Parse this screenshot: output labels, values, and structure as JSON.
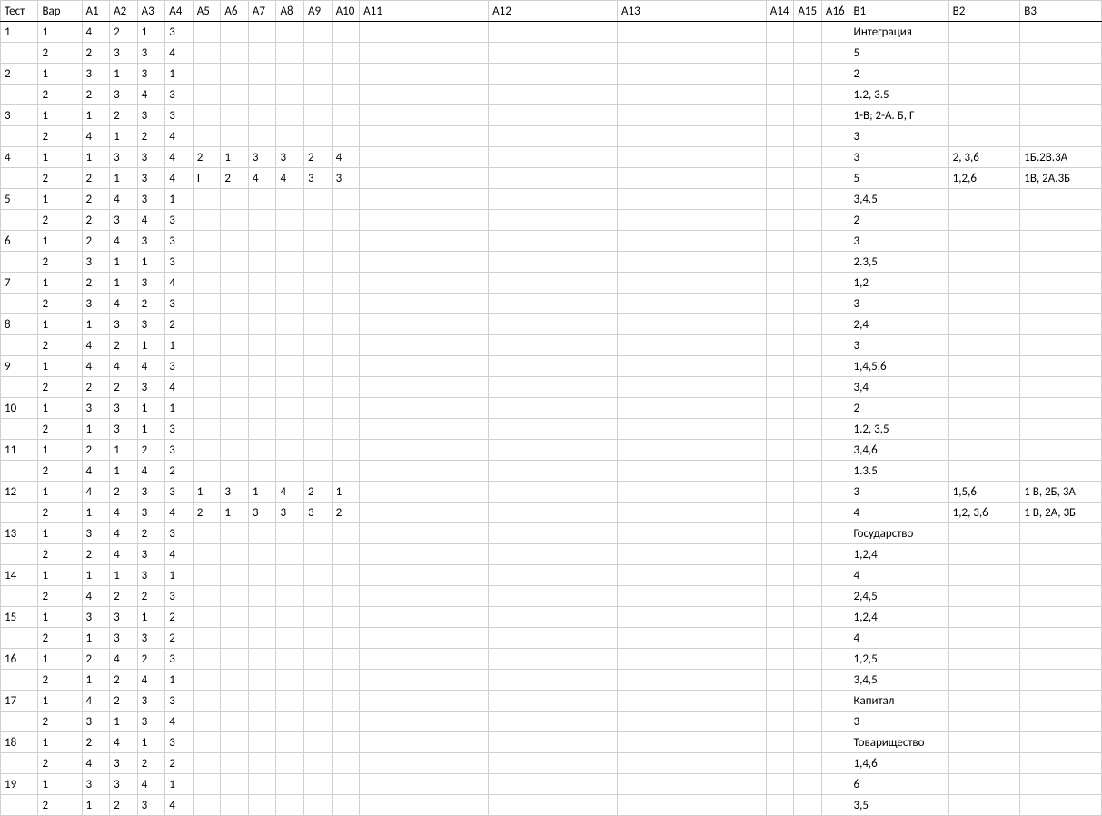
{
  "headers": [
    "Тест",
    "Вар",
    "А1",
    "А2",
    "А3",
    "А4",
    "А5",
    "А6",
    "А7",
    "А8",
    "А9",
    "А10",
    "А11",
    "А12",
    "А13",
    "А14",
    "А15",
    "А16",
    "В1",
    "В2",
    "В3"
  ],
  "rows": [
    [
      "1",
      "1",
      "4",
      "2",
      "1",
      "3",
      "",
      "",
      "",
      "",
      "",
      "",
      "",
      "",
      "",
      "",
      "",
      "",
      "Интеграция",
      "",
      ""
    ],
    [
      "",
      "2",
      "2",
      "3",
      "3",
      "4",
      "",
      "",
      "",
      "",
      "",
      "",
      "",
      "",
      "",
      "",
      "",
      "",
      "5",
      "",
      ""
    ],
    [
      "2",
      "1",
      "3",
      "1",
      "3",
      "1",
      "",
      "",
      "",
      "",
      "",
      "",
      "",
      "",
      "",
      "",
      "",
      "",
      "2",
      "",
      ""
    ],
    [
      "",
      "2",
      "2",
      "3",
      "4",
      "3",
      "",
      "",
      "",
      "",
      "",
      "",
      "",
      "",
      "",
      "",
      "",
      "",
      "1.2, 3.5",
      "",
      ""
    ],
    [
      "3",
      "1",
      "1",
      "2",
      "3",
      "3",
      "",
      "",
      "",
      "",
      "",
      "",
      "",
      "",
      "",
      "",
      "",
      "",
      "1-В; 2-А. Б, Г",
      "",
      ""
    ],
    [
      "",
      "2",
      "4",
      "1",
      "2",
      "4",
      "",
      "",
      "",
      "",
      "",
      "",
      "",
      "",
      "",
      "",
      "",
      "",
      "3",
      "",
      ""
    ],
    [
      "4",
      "1",
      "1",
      "3",
      "3",
      "4",
      "2",
      "1",
      "3",
      "3",
      "2",
      "4",
      "",
      "",
      "",
      "",
      "",
      "",
      "3",
      "2, 3,6",
      "1Б.2В.3А"
    ],
    [
      "",
      "2",
      "2",
      "1",
      "3",
      "4",
      "I",
      "2",
      "4",
      "4",
      "3",
      "3",
      "",
      "",
      "",
      "",
      "",
      "",
      "5",
      "1,2,6",
      "1В, 2А.3Б"
    ],
    [
      "5",
      "1",
      "2",
      "4",
      "3",
      "1",
      "",
      "",
      "",
      "",
      "",
      "",
      "",
      "",
      "",
      "",
      "",
      "",
      "3,4.5",
      "",
      ""
    ],
    [
      "",
      "2",
      "2",
      "3",
      "4",
      "3",
      "",
      "",
      "",
      "",
      "",
      "",
      "",
      "",
      "",
      "",
      "",
      "",
      "2",
      "",
      ""
    ],
    [
      "6",
      "1",
      "2",
      "4",
      "3",
      "3",
      "",
      "",
      "",
      "",
      "",
      "",
      "",
      "",
      "",
      "",
      "",
      "",
      "3",
      "",
      ""
    ],
    [
      "",
      "2",
      "3",
      "1",
      "1",
      "3",
      "",
      "",
      "",
      "",
      "",
      "",
      "",
      "",
      "",
      "",
      "",
      "",
      "2.3,5",
      "",
      ""
    ],
    [
      "7",
      "1",
      "2",
      "1",
      "3",
      "4",
      "",
      "",
      "",
      "",
      "",
      "",
      "",
      "",
      "",
      "",
      "",
      "",
      "1,2",
      "",
      ""
    ],
    [
      "",
      "2",
      "3",
      "4",
      "2",
      "3",
      "",
      "",
      "",
      "",
      "",
      "",
      "",
      "",
      "",
      "",
      "",
      "",
      "3",
      "",
      ""
    ],
    [
      "8",
      "1",
      "1",
      "3",
      "3",
      "2",
      "",
      "",
      "",
      "",
      "",
      "",
      "",
      "",
      "",
      "",
      "",
      "",
      "2,4",
      "",
      ""
    ],
    [
      "",
      "2",
      "4",
      "2",
      "1",
      "1",
      "",
      "",
      "",
      "",
      "",
      "",
      "",
      "",
      "",
      "",
      "",
      "",
      "3",
      "",
      ""
    ],
    [
      "9",
      "1",
      "4",
      "4",
      "4",
      "3",
      "",
      "",
      "",
      "",
      "",
      "",
      "",
      "",
      "",
      "",
      "",
      "",
      "1,4,5,6",
      "",
      ""
    ],
    [
      "",
      "2",
      "2",
      "2",
      "3",
      "4",
      "",
      "",
      "",
      "",
      "",
      "",
      "",
      "",
      "",
      "",
      "",
      "",
      "3,4",
      "",
      ""
    ],
    [
      "10",
      "1",
      "3",
      "3",
      "1",
      "1",
      "",
      "",
      "",
      "",
      "",
      "",
      "",
      "",
      "",
      "",
      "",
      "",
      "2",
      "",
      ""
    ],
    [
      "",
      "2",
      "1",
      "3",
      "1",
      "3",
      "",
      "",
      "",
      "",
      "",
      "",
      "",
      "",
      "",
      "",
      "",
      "",
      "1.2, 3,5",
      "",
      ""
    ],
    [
      "11",
      "1",
      "2",
      "1",
      "2",
      "3",
      "",
      "",
      "",
      "",
      "",
      "",
      "",
      "",
      "",
      "",
      "",
      "",
      "3,4,6",
      "",
      ""
    ],
    [
      "",
      "2",
      "4",
      "1",
      "4",
      "2",
      "",
      "",
      "",
      "",
      "",
      "",
      "",
      "",
      "",
      "",
      "",
      "",
      "1.3.5",
      "",
      ""
    ],
    [
      "12",
      "1",
      "4",
      "2",
      "3",
      "3",
      "1",
      "3",
      "1",
      "4",
      "2",
      "1",
      "",
      "",
      "",
      "",
      "",
      "",
      "3",
      "1,5,6",
      "1 В, 2Б, 3А"
    ],
    [
      "",
      "2",
      "1",
      "4",
      "3",
      "4",
      "2",
      "1",
      "3",
      "3",
      "3",
      "2",
      "",
      "",
      "",
      "",
      "",
      "",
      "4",
      "1,2, 3,6",
      "1 В, 2А, 3Б"
    ],
    [
      "13",
      "1",
      "3",
      "4",
      "2",
      "3",
      "",
      "",
      "",
      "",
      "",
      "",
      "",
      "",
      "",
      "",
      "",
      "",
      "Государство",
      "",
      ""
    ],
    [
      "",
      "2",
      "2",
      "4",
      "3",
      "4",
      "",
      "",
      "",
      "",
      "",
      "",
      "",
      "",
      "",
      "",
      "",
      "",
      "1,2,4",
      "",
      ""
    ],
    [
      "14",
      "1",
      "1",
      "1",
      "3",
      "1",
      "",
      "",
      "",
      "",
      "",
      "",
      "",
      "",
      "",
      "",
      "",
      "",
      "4",
      "",
      ""
    ],
    [
      "",
      "2",
      "4",
      "2",
      "2",
      "3",
      "",
      "",
      "",
      "",
      "",
      "",
      "",
      "",
      "",
      "",
      "",
      "",
      "2,4,5",
      "",
      ""
    ],
    [
      "15",
      "1",
      "3",
      "3",
      "1",
      "2",
      "",
      "",
      "",
      "",
      "",
      "",
      "",
      "",
      "",
      "",
      "",
      "",
      "1,2,4",
      "",
      ""
    ],
    [
      "",
      "2",
      "1",
      "3",
      "3",
      "2",
      "",
      "",
      "",
      "",
      "",
      "",
      "",
      "",
      "",
      "",
      "",
      "",
      "4",
      "",
      ""
    ],
    [
      "16",
      "1",
      "2",
      "4",
      "2",
      "3",
      "",
      "",
      "",
      "",
      "",
      "",
      "",
      "",
      "",
      "",
      "",
      "",
      "1,2,5",
      "",
      ""
    ],
    [
      "",
      "2",
      "1",
      "2",
      "4",
      "1",
      "",
      "",
      "",
      "",
      "",
      "",
      "",
      "",
      "",
      "",
      "",
      "",
      "3,4,5",
      "",
      ""
    ],
    [
      "17",
      "1",
      "4",
      "2",
      "3",
      "3",
      "",
      "",
      "",
      "",
      "",
      "",
      "",
      "",
      "",
      "",
      "",
      "",
      "Капитал",
      "",
      ""
    ],
    [
      "",
      "2",
      "3",
      "1",
      "3",
      "4",
      "",
      "",
      "",
      "",
      "",
      "",
      "",
      "",
      "",
      "",
      "",
      "",
      "3",
      "",
      ""
    ],
    [
      "18",
      "1",
      "2",
      "4",
      "1",
      "3",
      "",
      "",
      "",
      "",
      "",
      "",
      "",
      "",
      "",
      "",
      "",
      "",
      "Товарищество",
      "",
      ""
    ],
    [
      "",
      "2",
      "4",
      "3",
      "2",
      "2",
      "",
      "",
      "",
      "",
      "",
      "",
      "",
      "",
      "",
      "",
      "",
      "",
      "1,4,6",
      "",
      ""
    ],
    [
      "19",
      "1",
      "3",
      "3",
      "4",
      "1",
      "",
      "",
      "",
      "",
      "",
      "",
      "",
      "",
      "",
      "",
      "",
      "",
      "6",
      "",
      ""
    ],
    [
      "",
      "2",
      "1",
      "2",
      "3",
      "4",
      "",
      "",
      "",
      "",
      "",
      "",
      "",
      "",
      "",
      "",
      "",
      "",
      "3,5",
      "",
      ""
    ]
  ]
}
